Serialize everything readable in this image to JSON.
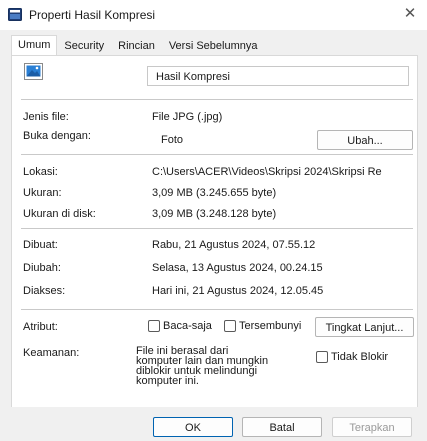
{
  "window": {
    "title": "Properti Hasil Kompresi",
    "close_glyph": "✕"
  },
  "tabs": [
    {
      "label": "Umum",
      "active": true
    },
    {
      "label": "Security"
    },
    {
      "label": "Rincian"
    },
    {
      "label": "Versi Sebelumnya"
    }
  ],
  "general": {
    "filename": "Hasil Kompresi",
    "file_type_label": "Jenis file:",
    "file_type_value": "File JPG (.jpg)",
    "open_with_label": "Buka dengan:",
    "open_with_value": "Foto",
    "change_button": "Ubah...",
    "location_label": "Lokasi:",
    "location_value": "C:\\Users\\ACER\\Videos\\Skripsi 2024\\Skripsi Re",
    "size_label": "Ukuran:",
    "size_value": "3,09 MB (3.245.655 byte)",
    "size_on_disk_label": "Ukuran di disk:",
    "size_on_disk_value": "3,09 MB (3.248.128 byte)",
    "created_label": "Dibuat:",
    "created_value": "Rabu, 21 Agustus 2024, 07.55.12",
    "modified_label": "Diubah:",
    "modified_value": "Selasa, 13 Agustus 2024, 00.24.15",
    "accessed_label": "Diakses:",
    "accessed_value": "Hari ini, 21 Agustus 2024, 12.05.45",
    "attributes_label": "Atribut:",
    "readonly_label": "Baca-saja",
    "hidden_label": "Tersembunyi",
    "advanced_button": "Tingkat Lanjut...",
    "security_label": "Keamanan:",
    "security_text_1": "File ini berasal dari",
    "security_text_2": "komputer lain dan mungkin",
    "security_text_3": "diblokir untuk melindungi",
    "security_text_4": "komputer ini.",
    "unblock_label": "Tidak Blokir"
  },
  "footer": {
    "ok": "OK",
    "cancel": "Batal",
    "apply": "Terapkan"
  },
  "icons": {
    "app": "properties-app-icon",
    "file": "jpg-image-file-icon"
  },
  "colors": {
    "accent": "#0063b1",
    "panel": "#ffffff",
    "chrome": "#f0f0f0"
  }
}
